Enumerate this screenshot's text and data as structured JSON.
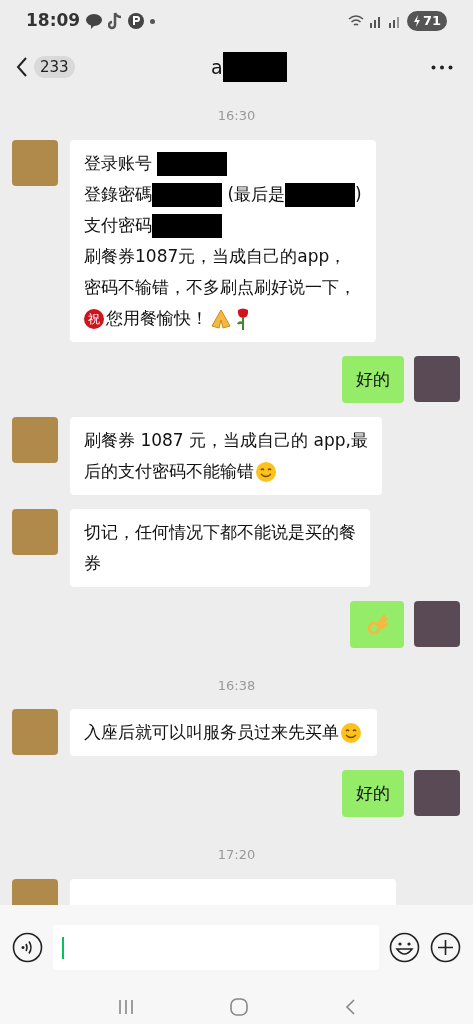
{
  "status_bar": {
    "time": "18:09",
    "battery": "71"
  },
  "header": {
    "unread_count": "233",
    "title": "a"
  },
  "messages": [
    {
      "kind": "time",
      "text": "16:30"
    },
    {
      "kind": "incoming",
      "lines": [
        [
          {
            "kind": "text",
            "text": "登录账号 "
          },
          {
            "kind": "redaction"
          }
        ],
        [
          {
            "kind": "text",
            "text": "登錄密碼"
          },
          {
            "kind": "redaction"
          },
          {
            "kind": "text",
            "text": " (最后是"
          },
          {
            "kind": "redaction"
          },
          {
            "kind": "text",
            "text": ")"
          }
        ],
        [
          {
            "kind": "text",
            "text": "支付密码"
          },
          {
            "kind": "redaction"
          }
        ],
        [
          {
            "kind": "text",
            "text": "刷餐券1087元，当成自己的app，"
          }
        ],
        [
          {
            "kind": "text",
            "text": "密码不输错，不多刷点刷好说一下，"
          }
        ],
        [
          {
            "kind": "badge",
            "text": "祝"
          },
          {
            "kind": "text",
            "text": "您用餐愉快！"
          },
          {
            "kind": "pray"
          },
          {
            "kind": "rose"
          }
        ]
      ]
    },
    {
      "kind": "outgoing",
      "lines": [
        [
          {
            "kind": "text",
            "text": "好的"
          }
        ]
      ]
    },
    {
      "kind": "incoming",
      "lines": [
        [
          {
            "kind": "text",
            "text": "刷餐券 1087 元，当成自己的 app,最"
          }
        ],
        [
          {
            "kind": "text",
            "text": "后的支付密码不能输错"
          },
          {
            "kind": "smile"
          }
        ]
      ]
    },
    {
      "kind": "incoming",
      "lines": [
        [
          {
            "kind": "text",
            "text": "切记，任何情况下都不能说是买的餐"
          }
        ],
        [
          {
            "kind": "text",
            "text": "券"
          }
        ]
      ]
    },
    {
      "kind": "outgoing",
      "lines": [
        [
          {
            "kind": "ok"
          }
        ]
      ]
    },
    {
      "kind": "time",
      "text": "16:38"
    },
    {
      "kind": "incoming",
      "lines": [
        [
          {
            "kind": "text",
            "text": "入座后就可以叫服务员过来先买单"
          },
          {
            "kind": "smile"
          }
        ]
      ]
    },
    {
      "kind": "outgoing",
      "lines": [
        [
          {
            "kind": "text",
            "text": "好的"
          }
        ]
      ]
    },
    {
      "kind": "time",
      "text": "17:20"
    },
    {
      "kind": "incoming"
    }
  ]
}
